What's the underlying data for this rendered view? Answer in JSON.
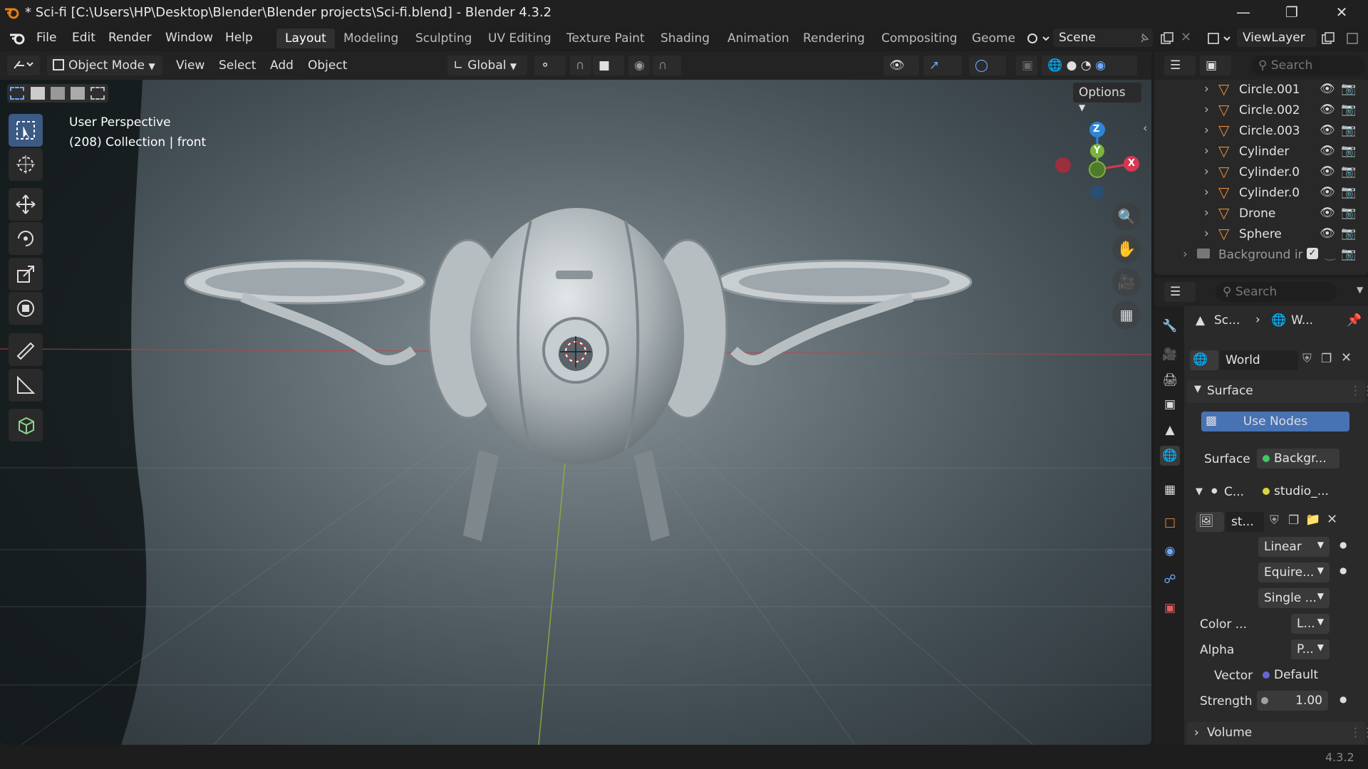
{
  "titlebar": {
    "title": "* Sci-fi [C:\\Users\\HP\\Desktop\\Blender\\Blender projects\\Sci-fi.blend] - Blender 4.3.2"
  },
  "menu": {
    "file": "File",
    "edit": "Edit",
    "render": "Render",
    "window": "Window",
    "help": "Help"
  },
  "workspaces": [
    "Layout",
    "Modeling",
    "Sculpting",
    "UV Editing",
    "Texture Paint",
    "Shading",
    "Animation",
    "Rendering",
    "Compositing",
    "Geome"
  ],
  "scene": {
    "name": "Scene",
    "view_layer": "ViewLayer"
  },
  "viewport_header": {
    "mode": "Object Mode",
    "view": "View",
    "select": "Select",
    "add": "Add",
    "object": "Object",
    "transform": "Global",
    "options": "Options"
  },
  "viewport": {
    "perspective": "User Perspective",
    "collection": "(208) Collection | front"
  },
  "gizmo": {
    "z": "Z",
    "y": "Y",
    "x": "X"
  },
  "outliner": {
    "search_placeholder": "Search",
    "items": [
      {
        "label": "Circle.001"
      },
      {
        "label": "Circle.002"
      },
      {
        "label": "Circle.003"
      },
      {
        "label": "Cylinder"
      },
      {
        "label": "Cylinder.0"
      },
      {
        "label": "Cylinder.0"
      },
      {
        "label": "Drone"
      },
      {
        "label": "Sphere"
      },
      {
        "label": "Background ir"
      }
    ]
  },
  "properties": {
    "search_placeholder": "Search",
    "breadcrumb_scene": "Sc...",
    "breadcrumb_world": "W...",
    "world_name": "World",
    "surface_section": "Surface",
    "use_nodes": "Use Nodes",
    "surface_label": "Surface",
    "surface_value": "Backgr...",
    "color_label": "C...",
    "color_value": "studio_...",
    "image_name": "st...",
    "interp": "Linear",
    "projection": "Equire...",
    "source": "Single ...",
    "color_space_label": "Color ...",
    "color_space_value": "L...",
    "alpha_label": "Alpha",
    "alpha_value": "P...",
    "vector_label": "Vector",
    "vector_value": "Default",
    "strength_label": "Strength",
    "strength_value": "1.00",
    "volume_section": "Volume"
  },
  "status": {
    "version": "4.3.2"
  },
  "colors": {
    "accent": "#4772b3",
    "object_orange": "#e58b3a",
    "axis_x": "#d9374f",
    "axis_y": "#7bb33c",
    "axis_z": "#2f86d6"
  }
}
